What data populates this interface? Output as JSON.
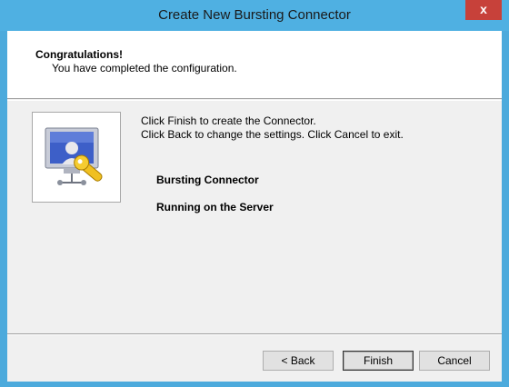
{
  "window": {
    "title": "Create New Bursting Connector",
    "close_label": "x"
  },
  "header": {
    "title": "Congratulations!",
    "subtitle": "You have completed the configuration."
  },
  "body": {
    "line1": "Click Finish to create the Connector.",
    "line2": "Click Back to change the settings. Click Cancel to exit.",
    "connector_label": "Bursting Connector",
    "status_label": "Running on the Server"
  },
  "buttons": {
    "back": "< Back",
    "finish": "Finish",
    "cancel": "Cancel"
  },
  "colors": {
    "titlebar": "#4fb0e2",
    "close": "#c7413a",
    "client": "#f0f0f0"
  },
  "icons": {
    "wizard": "monitor-with-key-icon"
  }
}
